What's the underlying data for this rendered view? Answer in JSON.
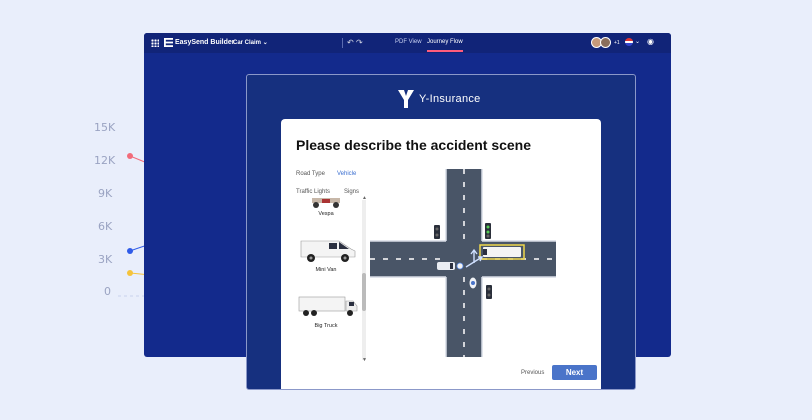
{
  "background_chart": {
    "y_ticks": [
      "15K",
      "12K",
      "9K",
      "6K",
      "3K",
      "0"
    ],
    "series_colors": {
      "red": "#f26b7a",
      "blue": "#2f5be8",
      "yellow": "#f5c33b"
    },
    "marker_color": "#ffffff"
  },
  "builder": {
    "app_name": "EasySend Builder",
    "document_select": "Car Claim",
    "tabs": {
      "pdf_view": "PDF View",
      "journey_flow": "Journey Flow"
    },
    "avatar_count": "+1",
    "colors": {
      "window": "#132a8c",
      "topbar": "#112478",
      "active_tab_underline": "#ff5c7c"
    }
  },
  "journey": {
    "brand": "Y-Insurance",
    "title": "Please describe the accident scene",
    "tabs": {
      "road_type": "Road Type",
      "vehicle": "Vehicle",
      "traffic_lights": "Traffic Lights",
      "signs": "Signs"
    },
    "vehicles": [
      {
        "label": "Vespa"
      },
      {
        "label": "Mini Van"
      },
      {
        "label": "Big Truck"
      }
    ],
    "help_label": "?",
    "previous_label": "Previous",
    "next_label": "Next",
    "colors": {
      "accent": "#3b6fd0",
      "next_button": "#4a74c9",
      "road": "#495567",
      "window": "#16307f"
    }
  }
}
